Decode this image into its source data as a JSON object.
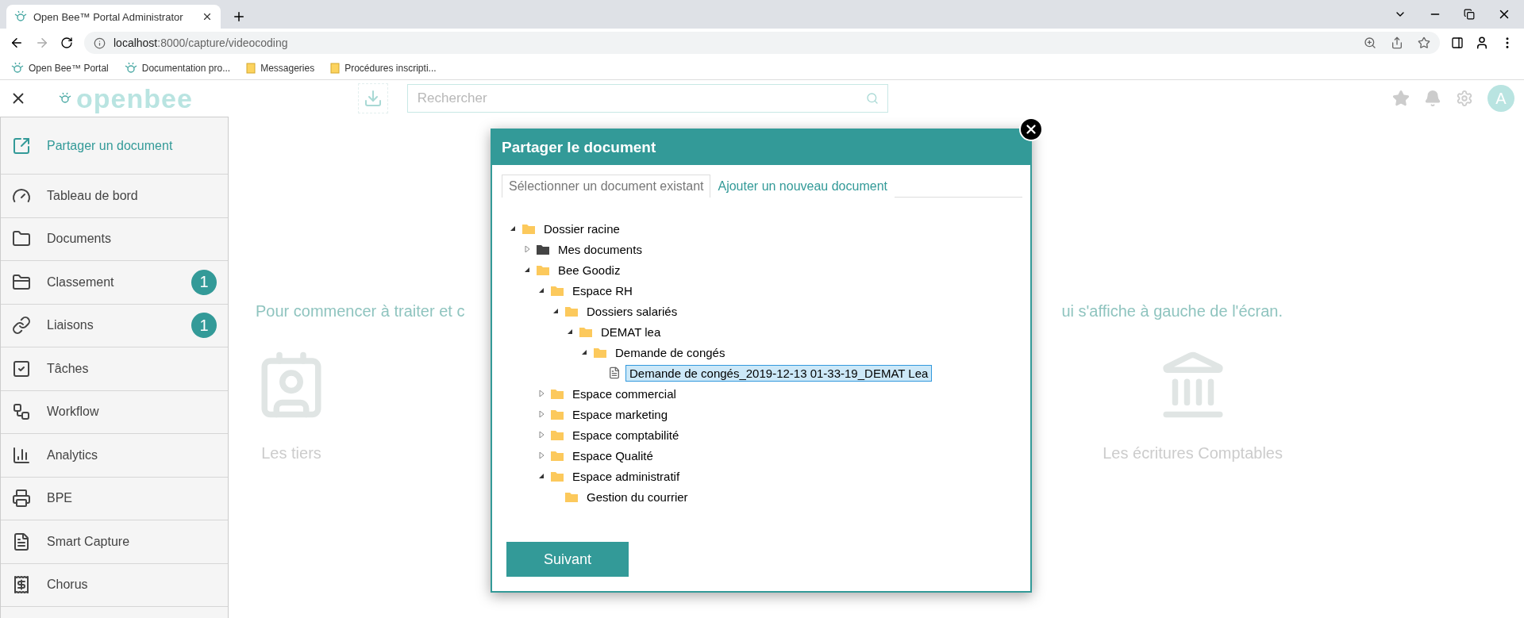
{
  "browser": {
    "tabs": [
      {
        "title": "Open Bee™ Portal Administrator",
        "selected": true
      }
    ],
    "url_host": "localhost",
    "url_path": ":8000/capture/videocoding",
    "bookmarks": [
      {
        "kind": "bee",
        "label": "Open Bee™ Portal"
      },
      {
        "kind": "bee",
        "label": "Documentation pro..."
      },
      {
        "kind": "folder",
        "label": "Messageries"
      },
      {
        "kind": "folder",
        "label": "Procédures inscripti..."
      }
    ]
  },
  "header": {
    "logo": "openbee",
    "search": {
      "placeholder": "Rechercher"
    },
    "avatar": "A"
  },
  "sidebar": {
    "items": [
      {
        "label": "Partager un document",
        "selected": true
      },
      {
        "label": "Tableau de bord",
        "selected": false
      },
      {
        "label": "Documents",
        "selected": false
      },
      {
        "label": "Classement",
        "selected": false,
        "badge": "1"
      },
      {
        "label": "Liaisons",
        "selected": false,
        "badge": "1"
      },
      {
        "label": "Tâches",
        "selected": false
      },
      {
        "label": "Workflow",
        "selected": false
      },
      {
        "label": "Analytics",
        "selected": false
      },
      {
        "label": "BPE",
        "selected": false
      },
      {
        "label": "Smart Capture",
        "selected": false
      },
      {
        "label": "Chorus",
        "selected": false
      }
    ]
  },
  "background": {
    "intro_left": "Pour commencer à traiter et c",
    "intro_right": "ui s'affiche à gauche de l'écran.",
    "cards": [
      {
        "label": "Les tiers"
      },
      {
        "label": "Les écritures Comptables"
      }
    ]
  },
  "dialog": {
    "title": "Partager le document",
    "tabs": [
      {
        "label": "Sélectionner un document existant",
        "selected": true
      },
      {
        "label": "Ajouter un nouveau document",
        "selected": false
      }
    ],
    "tree": [
      {
        "kind": "folder",
        "label": "Dossier racine",
        "expanded": true,
        "selected": false,
        "children": [
          {
            "kind": "dark-folder",
            "label": "Mes documents",
            "expanded": false,
            "selected": false
          },
          {
            "kind": "folder",
            "label": "Bee Goodiz",
            "expanded": true,
            "selected": false,
            "children": [
              {
                "kind": "folder",
                "label": "Espace RH",
                "expanded": true,
                "selected": false,
                "children": [
                  {
                    "kind": "folder",
                    "label": "Dossiers salariés",
                    "expanded": true,
                    "selected": false,
                    "children": [
                      {
                        "kind": "folder",
                        "label": "DEMAT lea",
                        "expanded": true,
                        "selected": false,
                        "children": [
                          {
                            "kind": "folder",
                            "label": "Demande de congés",
                            "expanded": true,
                            "selected": false,
                            "children": [
                              {
                                "kind": "document",
                                "label": "Demande de congés_2019-12-13 01-33-19_DEMAT Lea",
                                "selected": true
                              }
                            ]
                          }
                        ]
                      }
                    ]
                  }
                ]
              },
              {
                "kind": "folder",
                "label": "Espace commercial",
                "expanded": false,
                "selected": false
              },
              {
                "kind": "folder",
                "label": "Espace marketing",
                "expanded": false,
                "selected": false
              },
              {
                "kind": "folder",
                "label": "Espace comptabilité",
                "expanded": false,
                "selected": false
              },
              {
                "kind": "folder",
                "label": "Espace Qualité",
                "expanded": false,
                "selected": false
              },
              {
                "kind": "folder",
                "label": "Espace administratif",
                "expanded": true,
                "selected": false,
                "children": [
                  {
                    "kind": "folder",
                    "label": "Gestion du courrier",
                    "selected": false
                  }
                ]
              }
            ]
          }
        ]
      }
    ],
    "button": "Suivant"
  }
}
